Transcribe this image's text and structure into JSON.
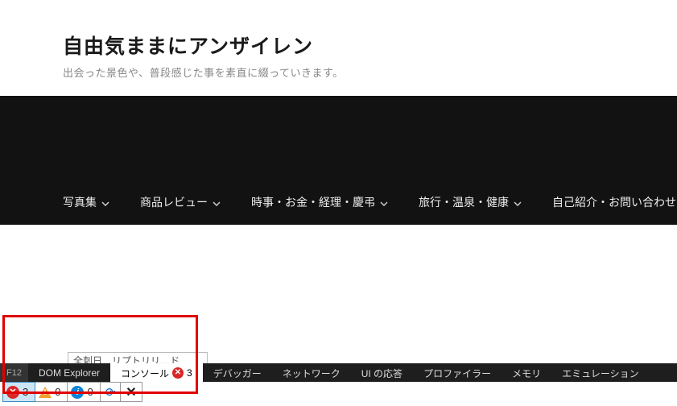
{
  "header": {
    "title": "自由気ままにアンザイレン",
    "subtitle": "出会った景色や、普段感じた事を素直に綴っていきます。"
  },
  "nav": {
    "items": [
      {
        "label": "写真集",
        "has_dropdown": true
      },
      {
        "label": "商品レビュー",
        "has_dropdown": true
      },
      {
        "label": "時事・お金・経理・慶弔",
        "has_dropdown": true
      },
      {
        "label": "旅行・温泉・健康",
        "has_dropdown": true
      },
      {
        "label": "自己紹介・お問い合わせ",
        "has_dropdown": false
      }
    ]
  },
  "partial_button": {
    "text": "全刺日…リプトリリ…ド"
  },
  "devtools": {
    "tabs": {
      "f12": "F12",
      "dom": "DOM Explorer",
      "console": "コンソール",
      "console_error_count": "3",
      "debugger": "デバッガー",
      "network": "ネットワーク",
      "ui": "UI の応答",
      "profiler": "プロファイラー",
      "memory": "メモリ",
      "emulation": "エミュレーション"
    },
    "status": {
      "errors": "3",
      "warnings": "0",
      "info": "0"
    }
  }
}
